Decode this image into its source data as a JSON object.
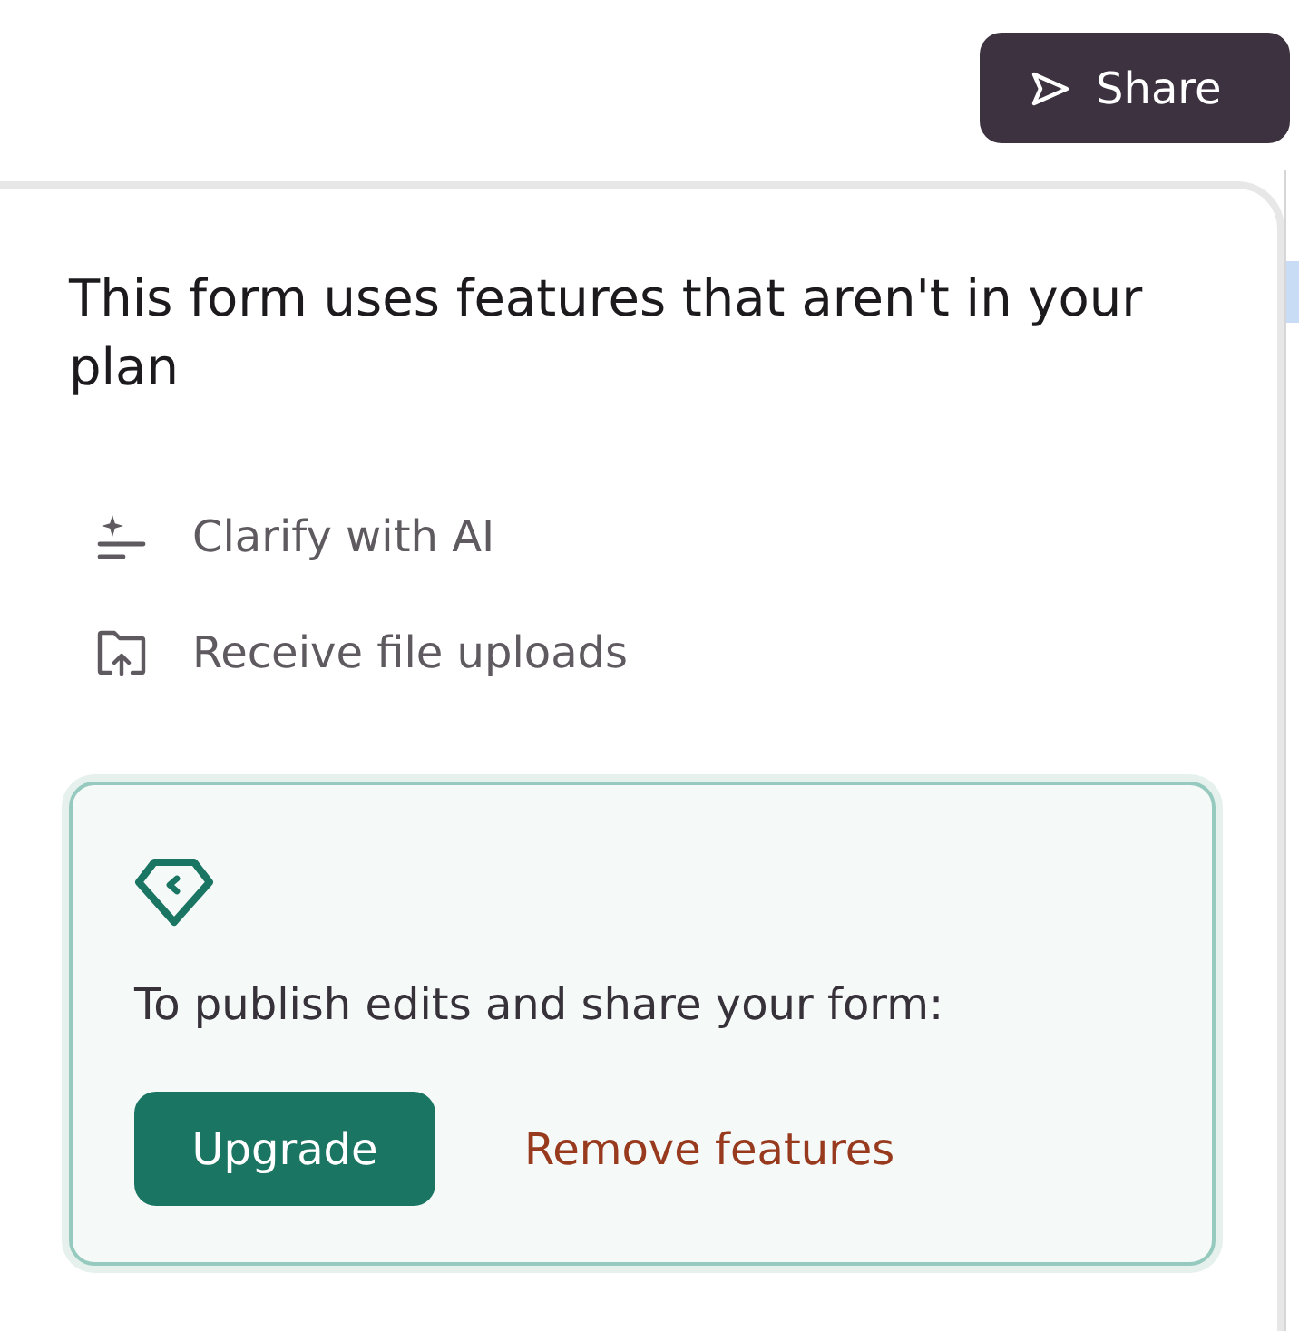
{
  "share_button": {
    "label": "Share"
  },
  "popover": {
    "title": "This form uses features that aren't in your plan",
    "features": [
      {
        "kind": "ai",
        "label": "Clarify with AI"
      },
      {
        "kind": "upload",
        "label": "Receive file uploads"
      }
    ],
    "upgrade_panel": {
      "message": "To publish edits and share your form:",
      "primary_button": "Upgrade",
      "link": "Remove features"
    }
  }
}
